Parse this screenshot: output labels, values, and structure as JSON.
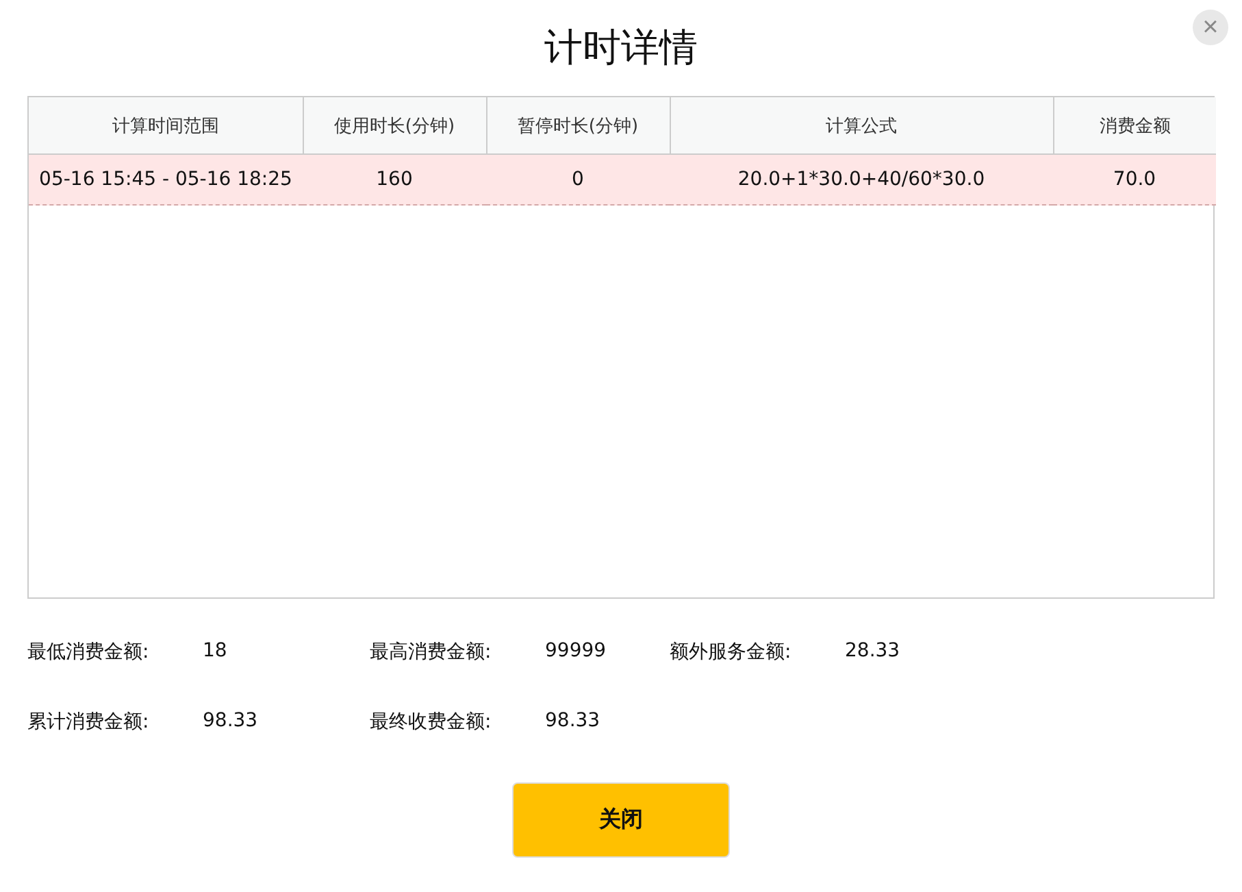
{
  "dialog": {
    "title": "计时详情",
    "close_icon": "×"
  },
  "table": {
    "columns": [
      "计算时间范围",
      "使用时长(分钟)",
      "暂停时长(分钟)",
      "计算公式",
      "消费金额"
    ],
    "rows": [
      {
        "selected": true,
        "cells": [
          "05-16 15:45 - 05-16 18:25",
          "160",
          "0",
          "20.0+1*30.0+40/60*30.0",
          "70.0"
        ]
      }
    ]
  },
  "summary": [
    [
      {
        "label": "最低消费金额:",
        "value": "18"
      },
      {
        "label": "最高消费金额:",
        "value": "99999"
      },
      {
        "label": "额外服务金额:",
        "value": "28.33"
      }
    ],
    [
      {
        "label": "累计消费金额:",
        "value": "98.33"
      },
      {
        "label": "最终收费金额:",
        "value": "98.33"
      }
    ]
  ],
  "buttons": [
    "关闭"
  ]
}
